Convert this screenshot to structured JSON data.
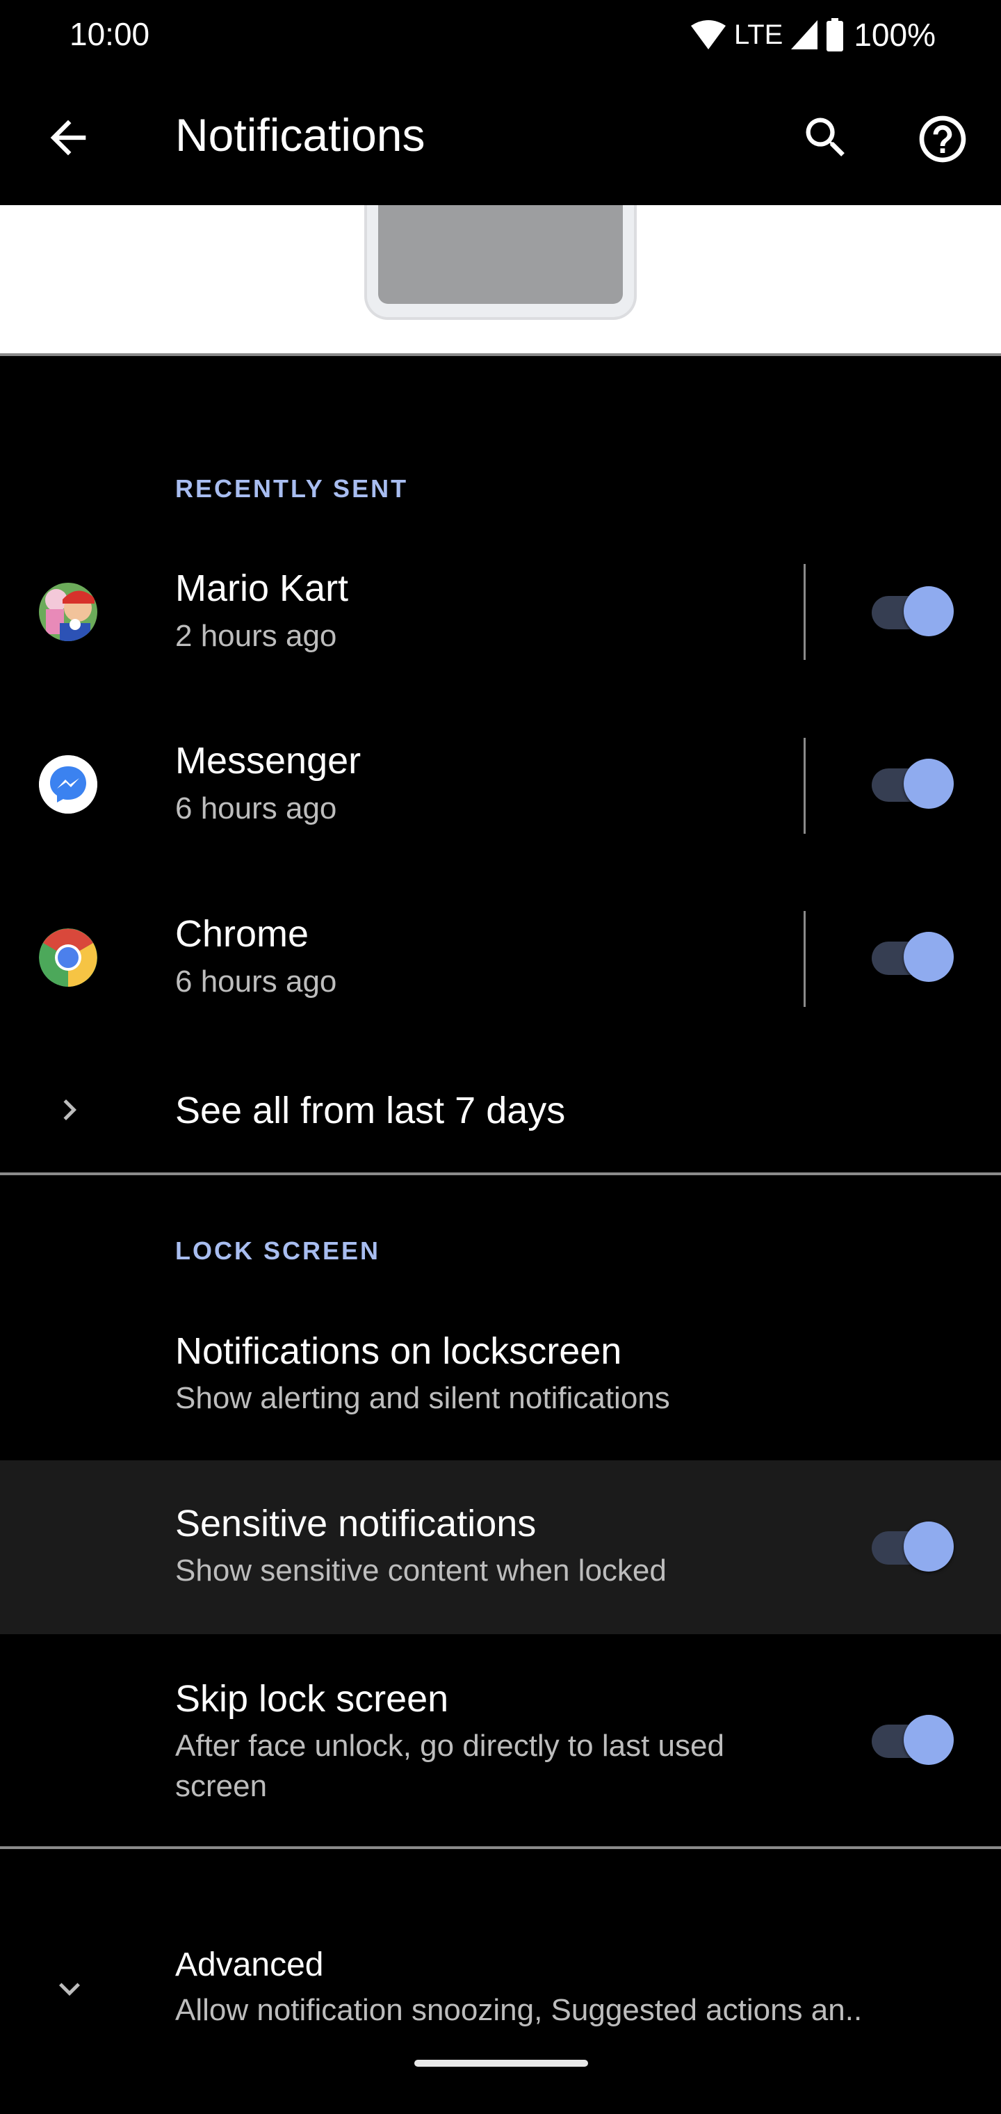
{
  "status_bar": {
    "time": "10:00",
    "network": "LTE",
    "battery": "100%",
    "icons": [
      "wifi-icon",
      "signal-icon",
      "battery-icon"
    ]
  },
  "app_bar": {
    "title": "Notifications",
    "back_icon": "arrow-back-icon",
    "search_icon": "search-icon",
    "help_icon": "help-icon"
  },
  "recently_sent": {
    "header": "RECENTLY SENT",
    "apps": [
      {
        "name": "Mario Kart",
        "time": "2 hours ago",
        "enabled": true,
        "icon": "mario-kart-icon"
      },
      {
        "name": "Messenger",
        "time": "6 hours ago",
        "enabled": true,
        "icon": "messenger-icon"
      },
      {
        "name": "Chrome",
        "time": "6 hours ago",
        "enabled": true,
        "icon": "chrome-icon"
      }
    ],
    "see_all": "See all from last 7 days"
  },
  "lock_screen": {
    "header": "LOCK SCREEN",
    "items": [
      {
        "title": "Notifications on lockscreen",
        "summary": "Show alerting and silent notifications"
      },
      {
        "title": "Sensitive notifications",
        "summary": "Show sensitive content when locked",
        "enabled": true
      },
      {
        "title": "Skip lock screen",
        "summary": "After face unlock, go directly to last used screen",
        "enabled": true
      }
    ]
  },
  "advanced": {
    "title": "Advanced",
    "summary": "Allow notification snoozing, Suggested actions an.."
  },
  "colors": {
    "accent": "#8fabef",
    "track": "#363e52",
    "header": "#a8bdf0",
    "highlight_row": "#1b1b1b"
  }
}
